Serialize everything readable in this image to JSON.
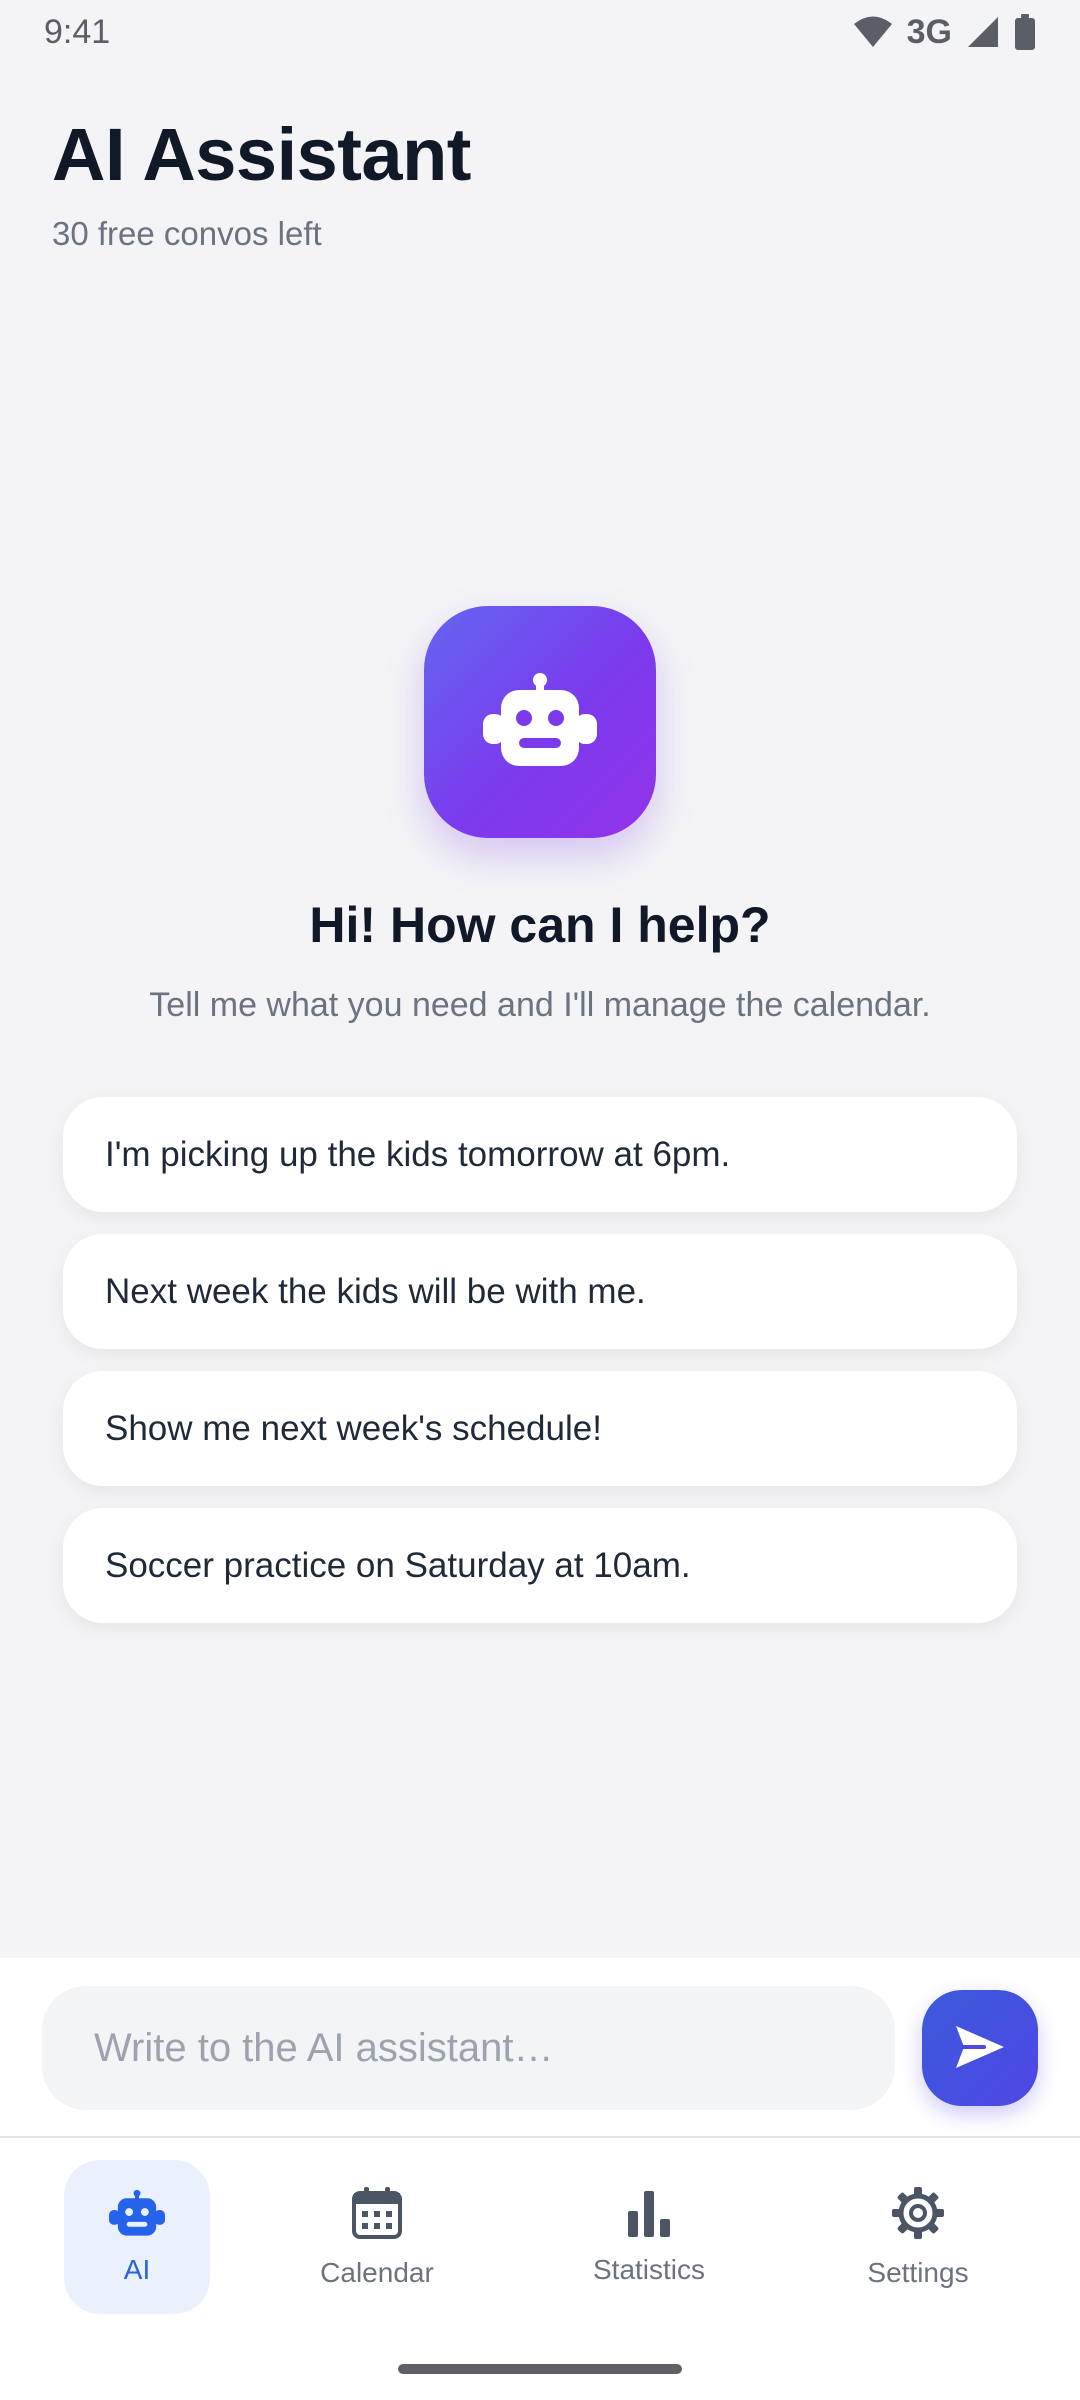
{
  "status_bar": {
    "time": "9:41",
    "network": "3G",
    "icons": [
      "wifi-icon",
      "signal-icon",
      "battery-icon"
    ]
  },
  "header": {
    "title": "AI Assistant",
    "subtitle": "30 free convos left"
  },
  "hero": {
    "icon": "robot-icon",
    "title": "Hi! How can I help?",
    "subtitle": "Tell me what you need and I'll manage the calendar."
  },
  "suggestions": [
    {
      "label": "I'm picking up the kids tomorrow at 6pm."
    },
    {
      "label": "Next week the kids will be with me."
    },
    {
      "label": "Show me next week's schedule!"
    },
    {
      "label": "Soccer practice on Saturday at 10am."
    }
  ],
  "composer": {
    "placeholder": "Write to the AI assistant…",
    "value": "",
    "send_icon": "send-icon"
  },
  "nav": {
    "items": [
      {
        "label": "AI",
        "icon": "robot-icon",
        "active": true
      },
      {
        "label": "Calendar",
        "icon": "calendar-icon",
        "active": false
      },
      {
        "label": "Statistics",
        "icon": "bar-chart-icon",
        "active": false
      },
      {
        "label": "Settings",
        "icon": "gear-icon",
        "active": false
      }
    ]
  },
  "colors": {
    "accent": "#2563eb",
    "hero_gradient_start": "#6366f1",
    "hero_gradient_end": "#9333ea",
    "background": "#f4f4f6",
    "text_primary": "#111827",
    "text_secondary": "#6b7280"
  }
}
